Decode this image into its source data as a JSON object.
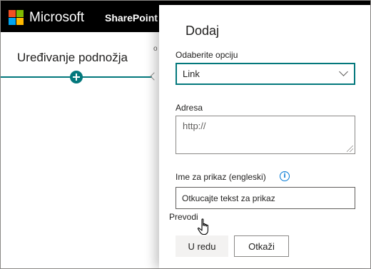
{
  "suite_bar": {
    "brand": "Microsoft",
    "app": "SharePoint",
    "logo_colors": [
      "#f25022",
      "#7fba00",
      "#00a4ef",
      "#ffb900"
    ],
    "background": "#000000"
  },
  "page": {
    "footer_title": "Uređivanje podnožja",
    "partial_text": "o",
    "accent_color": "#03787c"
  },
  "panel": {
    "title": "Dodaj",
    "option_label": "Odaberite opciju",
    "option_value": "Link",
    "address_label": "Adresa",
    "address_placeholder": "http://",
    "display_name_label": "Ime za prikaz (engleski)",
    "display_name_value": "Otkucajte tekst za prikaz",
    "translations_label": "Prevodi",
    "ok_button": "U redu",
    "cancel_button": "Otkaži"
  },
  "icons": {
    "info": "info-icon",
    "dropdown": "chevron-down-icon",
    "pointer": "hand-pointer-icon"
  }
}
